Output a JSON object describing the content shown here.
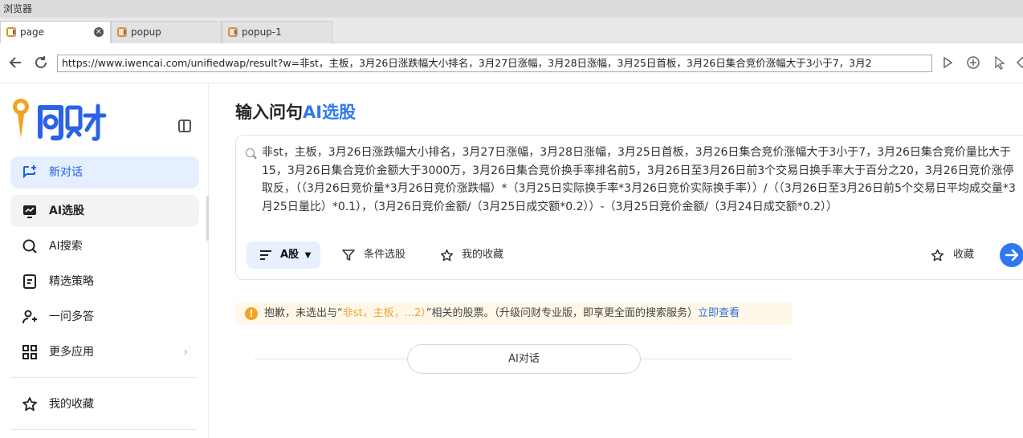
{
  "window": {
    "title": "浏览器"
  },
  "tabs": [
    {
      "label": "page",
      "active": true,
      "closable": true
    },
    {
      "label": "popup",
      "active": false
    },
    {
      "label": "popup-1",
      "active": false
    }
  ],
  "address_bar": {
    "url": "https://www.iwencai.com/unifiedwap/result?w=非st，主板，3月26日涨跌幅大小排名，3月27日涨幅，3月28日涨幅，3月25日首板，3月26日集合竞价涨幅大于3小于7，3月2"
  },
  "sidebar": {
    "logo_text": "问财",
    "items": [
      {
        "label": "新对话",
        "icon": "new-chat-icon"
      },
      {
        "label": "AI选股",
        "icon": "ai-stock-icon"
      },
      {
        "label": "AI搜索",
        "icon": "ai-search-icon"
      },
      {
        "label": "精选策略",
        "icon": "strategy-icon"
      },
      {
        "label": "一问多答",
        "icon": "multi-answer-icon"
      },
      {
        "label": "更多应用",
        "icon": "apps-grid-icon"
      },
      {
        "label": "我的收藏",
        "icon": "star-icon"
      }
    ]
  },
  "main": {
    "heading_prefix": "输入问句",
    "heading_accent": "AI选股",
    "query": "非st，主板，3月26日涨跌幅大小排名，3月27日涨幅，3月28日涨幅，3月25日首板，3月26日集合竞价涨幅大于3小于7，3月26日集合竞价量比大于15，3月26日集合竞价金额大于3000万，3月26日集合竞价换手率排名前5，3月26日至3月26日前3个交易日换手率大于百分之20，3月26日竞价涨停取反，（（3月26日竞价量*3月26日竞价涨跌幅）*（3月25日实际换手率*3月26日竞价实际换手率））/（（3月26日至3月26日前5个交易日平均成交量*3月25日量比）*0.1），（3月26日竞价金额/（3月25日成交额*0.2））-（3月25日竞价金额/（3月24日成交额*0.2））",
    "buttons": {
      "market": "A股",
      "filter": "条件选股",
      "favorites": "我的收藏",
      "collect": "收藏"
    },
    "notice": {
      "prefix": "抱歉，未选出与“",
      "highlight": "非st，主板，...2）",
      "suffix": "”相关的股票。（升级问财专业版，即享更全面的搜索服务）",
      "link": "立即查看"
    },
    "ai_chat_label": "AI对话"
  },
  "colors": {
    "accent": "#2f78f0",
    "new_chat_bg": "#e6efff",
    "notice_bg": "#fff8e8",
    "warning": "#f2a321",
    "logo_orange": "#f2a321"
  }
}
